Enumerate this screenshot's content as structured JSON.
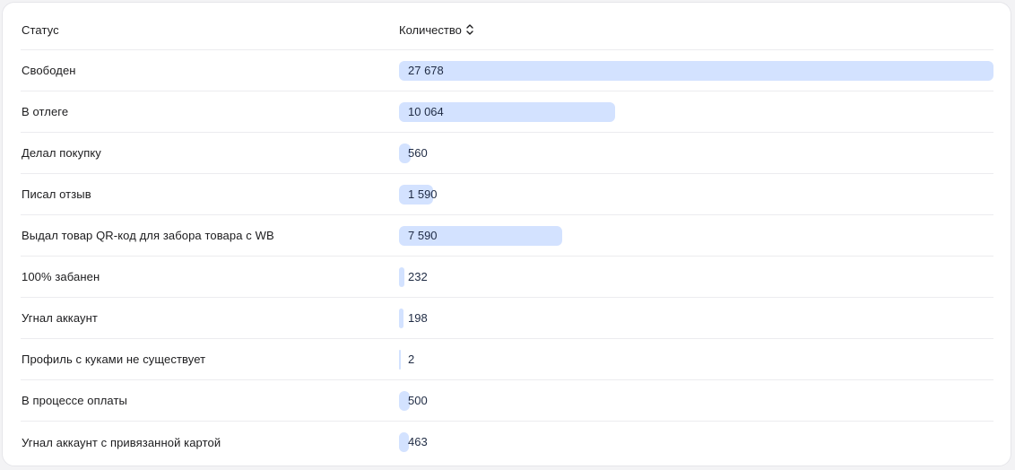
{
  "table": {
    "header": {
      "status": "Статус",
      "count": "Количество"
    },
    "max_value": 27678,
    "bar_color": "#d3e2ff",
    "rows": [
      {
        "status": "Свободен",
        "count_label": "27 678",
        "count": 27678
      },
      {
        "status": "В отлеге",
        "count_label": "10 064",
        "count": 10064
      },
      {
        "status": "Делал покупку",
        "count_label": "560",
        "count": 560
      },
      {
        "status": "Писал отзыв",
        "count_label": "1 590",
        "count": 1590
      },
      {
        "status": "Выдал товар QR-код для забора товара с WB",
        "count_label": "7 590",
        "count": 7590
      },
      {
        "status": "100% забанен",
        "count_label": "232",
        "count": 232
      },
      {
        "status": "Угнал аккаунт",
        "count_label": "198",
        "count": 198
      },
      {
        "status": "Профиль с куками не существует",
        "count_label": "2",
        "count": 2
      },
      {
        "status": "В процессе оплаты",
        "count_label": "500",
        "count": 500
      },
      {
        "status": "Угнал аккаунт с привязанной картой",
        "count_label": "463",
        "count": 463
      }
    ]
  }
}
